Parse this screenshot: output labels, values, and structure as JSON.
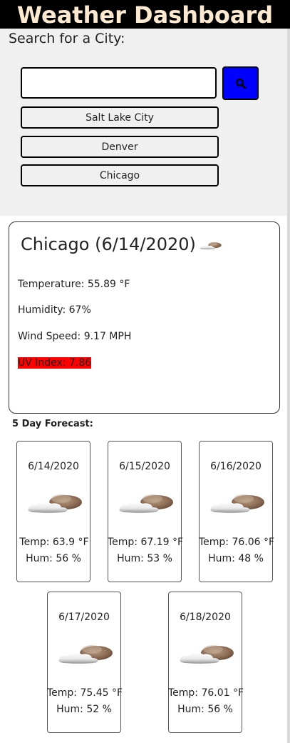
{
  "header": {
    "title": "Weather Dashboard"
  },
  "search": {
    "title": "Search for a City:",
    "input_value": "",
    "button_icon": "search-icon",
    "button_color": "#0000ff",
    "history": [
      "Salt Lake City",
      "Denver",
      "Chicago"
    ]
  },
  "current": {
    "title": "Chicago (6/14/2020)",
    "icon": "cloud-icon",
    "temperature": "Temperature: 55.89 °F",
    "humidity": "Humidity: 67%",
    "wind": "Wind Speed: 9.17 MPH",
    "uv": "UV Index: 7.86",
    "uv_color": "#ff0000"
  },
  "forecast": {
    "title": "5 Day Forecast:",
    "days": [
      {
        "date": "6/14/2020",
        "icon": "cloud-icon",
        "temp": "Temp: 63.9 °F",
        "hum": "Hum: 56 %"
      },
      {
        "date": "6/15/2020",
        "icon": "cloud-icon",
        "temp": "Temp: 67.19 °F",
        "hum": "Hum: 53 %"
      },
      {
        "date": "6/16/2020",
        "icon": "cloud-icon",
        "temp": "Temp: 76.06 °F",
        "hum": "Hum: 48 %"
      },
      {
        "date": "6/17/2020",
        "icon": "cloud-icon",
        "temp": "Temp: 75.45 °F",
        "hum": "Hum: 52 %"
      },
      {
        "date": "6/18/2020",
        "icon": "cloud-icon",
        "temp": "Temp: 76.01 °F",
        "hum": "Hum: 56 %"
      }
    ]
  }
}
